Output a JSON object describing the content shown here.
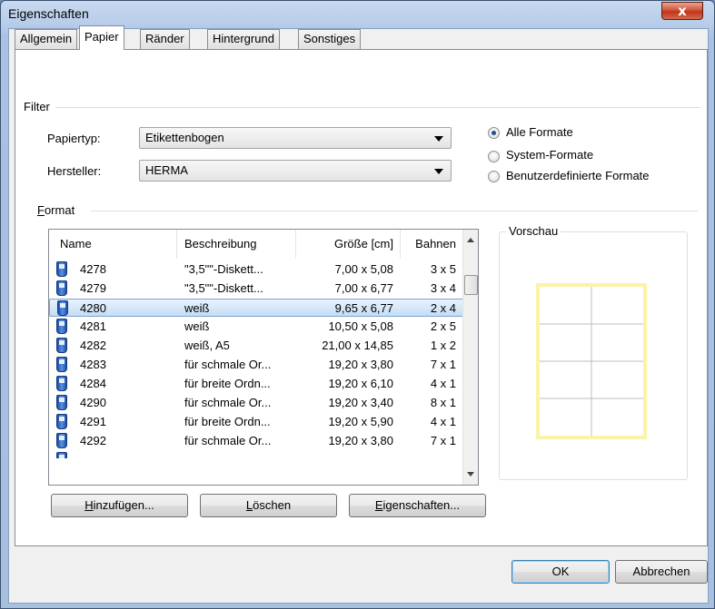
{
  "window": {
    "title": "Eigenschaften",
    "close_glyph": "x"
  },
  "tabs": [
    {
      "label": "Allgemein",
      "active": false
    },
    {
      "label": "Papier",
      "active": true
    },
    {
      "label": "Ränder",
      "active": false
    },
    {
      "label": "Hintergrund",
      "active": false
    },
    {
      "label": "Sonstiges",
      "active": false
    }
  ],
  "filter": {
    "group_label": "Filter",
    "papiertyp_label": "Papiertyp:",
    "papiertyp_value": "Etikettenbogen",
    "hersteller_label": "Hersteller:",
    "hersteller_value": "HERMA",
    "radio_options": [
      {
        "label": "Alle Formate",
        "checked": true
      },
      {
        "label": "System-Formate",
        "checked": false
      },
      {
        "label": "Benutzerdefinierte Formate",
        "checked": false
      }
    ]
  },
  "format": {
    "group_label_first": "F",
    "group_label_rest": "ormat",
    "columns": [
      "Name",
      "Beschreibung",
      "Größe [cm]",
      "Bahnen"
    ],
    "rows": [
      {
        "name": "4278",
        "desc": "\"3,5\"\"-Diskett...",
        "size": "7,00 x 5,08",
        "lanes": "3 x 5",
        "selected": false
      },
      {
        "name": "4279",
        "desc": "\"3,5\"\"-Diskett...",
        "size": "7,00 x 6,77",
        "lanes": "3 x 4",
        "selected": false
      },
      {
        "name": "4280",
        "desc": "weiß",
        "size": "9,65 x 6,77",
        "lanes": "2 x 4",
        "selected": true
      },
      {
        "name": "4281",
        "desc": "weiß",
        "size": "10,50 x 5,08",
        "lanes": "2 x 5",
        "selected": false
      },
      {
        "name": "4282",
        "desc": "weiß, A5",
        "size": "21,00 x 14,85",
        "lanes": "1 x 2",
        "selected": false
      },
      {
        "name": "4283",
        "desc": "für schmale Or...",
        "size": "19,20 x 3,80",
        "lanes": "7 x 1",
        "selected": false
      },
      {
        "name": "4284",
        "desc": "für breite Ordn...",
        "size": "19,20 x 6,10",
        "lanes": "4 x 1",
        "selected": false
      },
      {
        "name": "4290",
        "desc": "für schmale Or...",
        "size": "19,20 x 3,40",
        "lanes": "8 x 1",
        "selected": false
      },
      {
        "name": "4291",
        "desc": "für breite Ordn...",
        "size": "19,20 x 5,90",
        "lanes": "4 x 1",
        "selected": false
      },
      {
        "name": "4292",
        "desc": "für schmale Or...",
        "size": "19,20 x 3,80",
        "lanes": "7 x 1",
        "selected": false
      }
    ]
  },
  "preview": {
    "label": "Vorschau",
    "label_cols": 2,
    "label_rows": 4,
    "border_color": "#fbf3a8",
    "grid_color": "#bdbdbd"
  },
  "buttons": {
    "add": {
      "mnemonic": "H",
      "rest": "inzufügen..."
    },
    "delete": {
      "mnemonic": "L",
      "rest": "öschen"
    },
    "properties": {
      "mnemonic": "E",
      "rest": "igenschaften..."
    },
    "ok": "OK",
    "cancel": "Abbrechen"
  },
  "colors": {
    "selection": "#c4ddf5",
    "close_button": "#c23418",
    "radio_dot": "#1f4f8e"
  }
}
